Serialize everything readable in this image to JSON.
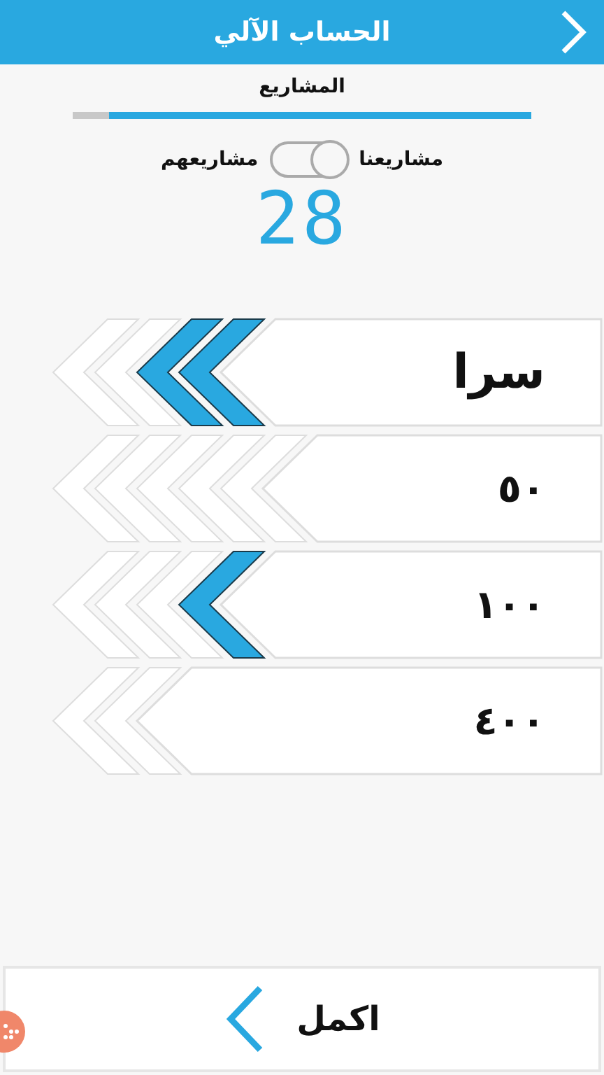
{
  "header": {
    "title": "الحساب الآلي"
  },
  "section_title": "المشاريع",
  "progress": {
    "level": 0.92
  },
  "toggle": {
    "label_right": "مشاريعنا",
    "label_left": "مشاريعهم",
    "on": true
  },
  "counter": "28",
  "options": [
    {
      "label": "سرا",
      "chevrons": [
        {
          "filled": true
        },
        {
          "filled": true
        },
        {
          "filled": false
        },
        {
          "filled": false
        }
      ]
    },
    {
      "label": "٥٠",
      "chevrons": [
        {
          "filled": false
        },
        {
          "filled": false
        },
        {
          "filled": false
        },
        {
          "filled": false
        },
        {
          "filled": false
        }
      ]
    },
    {
      "label": "١٠٠",
      "chevrons": [
        {
          "filled": true
        },
        {
          "filled": false
        },
        {
          "filled": false
        },
        {
          "filled": false
        }
      ]
    },
    {
      "label": "٤٠٠",
      "chevrons": [
        {
          "filled": false
        },
        {
          "filled": false
        }
      ]
    }
  ],
  "next_button": {
    "label": "اكمل"
  }
}
